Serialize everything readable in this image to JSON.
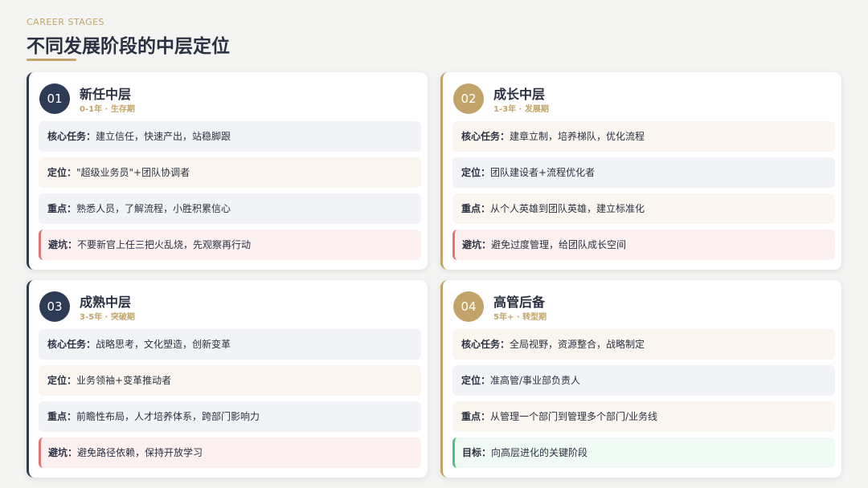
{
  "header": {
    "eyebrow": "CAREER STAGES",
    "title": "不同发展阶段的中层定位"
  },
  "colors": {
    "navy": "#2e3b55",
    "gold": "#c2a46a",
    "warning_red": "#e07575",
    "goal_green": "#4cc27e"
  },
  "stages": [
    {
      "number": "01",
      "name": "新任中层",
      "subtitle": "0-1年 · 生存期",
      "rows": [
        {
          "label": "核心任务：",
          "text": "建立信任，快速产出，站稳脚跟"
        },
        {
          "label": "定位：",
          "text": "\"超级业务员\"+团队协调者"
        },
        {
          "label": "重点：",
          "text": "熟悉人员，了解流程，小胜积累信心"
        },
        {
          "label": "避坑：",
          "text": "不要新官上任三把火乱烧，先观察再行动"
        }
      ]
    },
    {
      "number": "02",
      "name": "成长中层",
      "subtitle": "1-3年 · 发展期",
      "rows": [
        {
          "label": "核心任务：",
          "text": "建章立制，培养梯队，优化流程"
        },
        {
          "label": "定位：",
          "text": "团队建设者+流程优化者"
        },
        {
          "label": "重点：",
          "text": "从个人英雄到团队英雄，建立标准化"
        },
        {
          "label": "避坑：",
          "text": "避免过度管理，给团队成长空间"
        }
      ]
    },
    {
      "number": "03",
      "name": "成熟中层",
      "subtitle": "3-5年 · 突破期",
      "rows": [
        {
          "label": "核心任务：",
          "text": "战略思考，文化塑造，创新变革"
        },
        {
          "label": "定位：",
          "text": "业务领袖+变革推动者"
        },
        {
          "label": "重点：",
          "text": "前瞻性布局，人才培养体系，跨部门影响力"
        },
        {
          "label": "避坑：",
          "text": "避免路径依赖，保持开放学习"
        }
      ]
    },
    {
      "number": "04",
      "name": "高管后备",
      "subtitle": "5年+ · 转型期",
      "rows": [
        {
          "label": "核心任务：",
          "text": "全局视野，资源整合，战略制定"
        },
        {
          "label": "定位：",
          "text": "准高管/事业部负责人"
        },
        {
          "label": "重点：",
          "text": "从管理一个部门到管理多个部门/业务线"
        },
        {
          "label": "目标：",
          "text": "向高层进化的关键阶段"
        }
      ]
    }
  ]
}
